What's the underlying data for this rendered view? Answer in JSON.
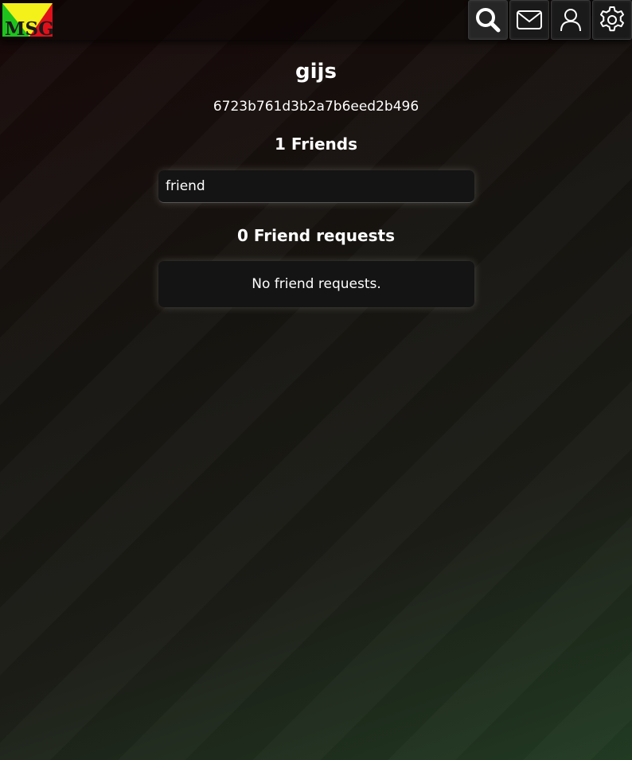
{
  "header": {
    "logo_text": "MSG",
    "nav": [
      {
        "icon": "search-icon"
      },
      {
        "icon": "mail-icon"
      },
      {
        "icon": "user-icon"
      },
      {
        "icon": "gear-icon"
      }
    ]
  },
  "profile": {
    "username": "gijs",
    "user_id": "6723b761d3b2a7b6eed2b496"
  },
  "friends": {
    "title": "1 Friends",
    "items": [
      {
        "name": "friend"
      }
    ]
  },
  "requests": {
    "title": "0 Friend requests",
    "empty_message": "No friend requests."
  },
  "colors": {
    "logo_green": "#1ec31e",
    "logo_yellow": "#f3f01a",
    "logo_red": "#e0101a"
  }
}
